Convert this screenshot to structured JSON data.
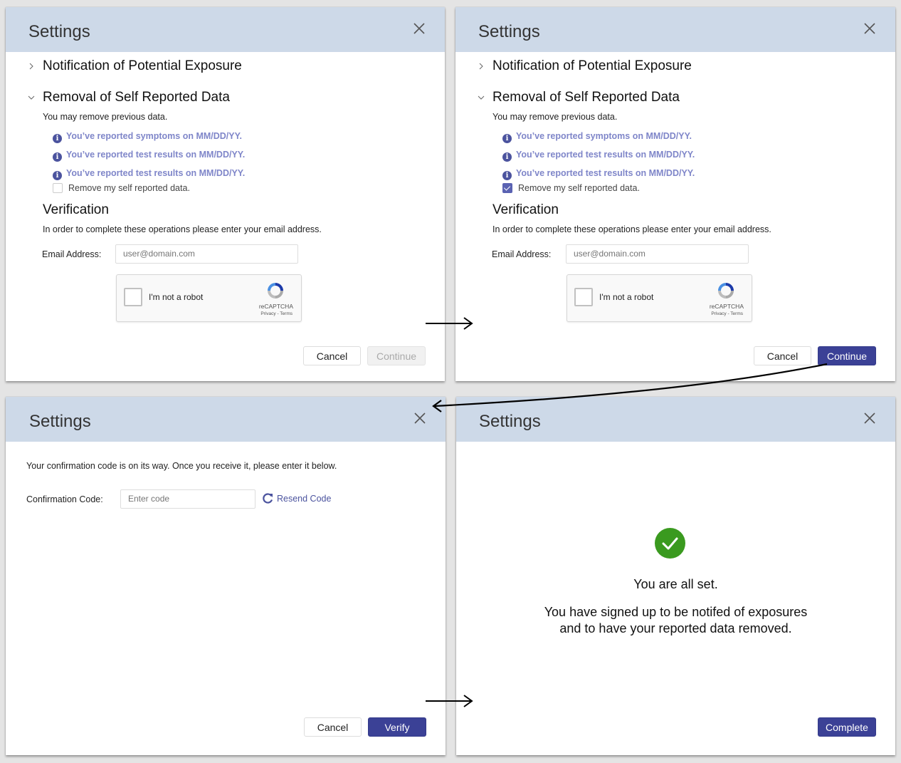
{
  "colors": {
    "header_bg": "#cdd9e8",
    "primary": "#3b4196",
    "info_text": "#7f86c9",
    "success": "#3a9a1f",
    "link": "#4b539e"
  },
  "panels": [
    {
      "title": "Settings",
      "close_icon": "close-icon",
      "sections": [
        {
          "label": "Notification of Potential Exposure",
          "expanded": false
        },
        {
          "label": "Removal of Self Reported Data",
          "expanded": true
        }
      ],
      "removal_intro": "You may remove previous data.",
      "reports": [
        "You’ve reported symptoms on MM/DD/YY.",
        "You’ve reported test results on MM/DD/YY.",
        "You’ve reported test results on MM/DD/YY."
      ],
      "remove_checkbox": {
        "label": "Remove my self reported data.",
        "checked": false
      },
      "verification_heading": "Verification",
      "verification_text": "In order to complete these operations please enter your email address.",
      "email_label": "Email Address:",
      "email_placeholder": "user@domain.com",
      "email_value": "",
      "captcha": {
        "label": "I'm not a robot",
        "brand": "reCAPTCHA",
        "links": "Privacy - Terms",
        "checked": false
      },
      "cancel_label": "Cancel",
      "continue_label": "Continue",
      "continue_enabled": false
    },
    {
      "title": "Settings",
      "close_icon": "close-icon",
      "sections": [
        {
          "label": "Notification of Potential Exposure",
          "expanded": false
        },
        {
          "label": "Removal of Self Reported Data",
          "expanded": true
        }
      ],
      "removal_intro": "You may remove previous data.",
      "reports": [
        "You’ve reported symptoms on MM/DD/YY.",
        "You’ve reported test results on MM/DD/YY.",
        "You’ve reported test results on MM/DD/YY."
      ],
      "remove_checkbox": {
        "label": "Remove my self reported data.",
        "checked": true
      },
      "verification_heading": "Verification",
      "verification_text": "In order to complete these operations please enter your email address.",
      "email_label": "Email Address:",
      "email_placeholder": "user@domain.com",
      "email_value": "",
      "captcha": {
        "label": "I'm not a robot",
        "brand": "reCAPTCHA",
        "links": "Privacy - Terms",
        "checked": false
      },
      "cancel_label": "Cancel",
      "continue_label": "Continue",
      "continue_enabled": true
    },
    {
      "title": "Settings",
      "close_icon": "close-icon",
      "message": "Your confirmation code is on its way.  Once you receive it, please enter it below.",
      "code_label": "Confirmation Code:",
      "code_placeholder": "Enter code",
      "code_value": "",
      "resend_label": "Resend Code",
      "cancel_label": "Cancel",
      "verify_label": "Verify"
    },
    {
      "title": "Settings",
      "close_icon": "close-icon",
      "success_icon": "check-circle-icon",
      "headline": "You are all set.",
      "detail_line1": "You have signed up to be notifed of exposures",
      "detail_line2": "and to have your reported data removed.",
      "complete_label": "Complete"
    }
  ]
}
